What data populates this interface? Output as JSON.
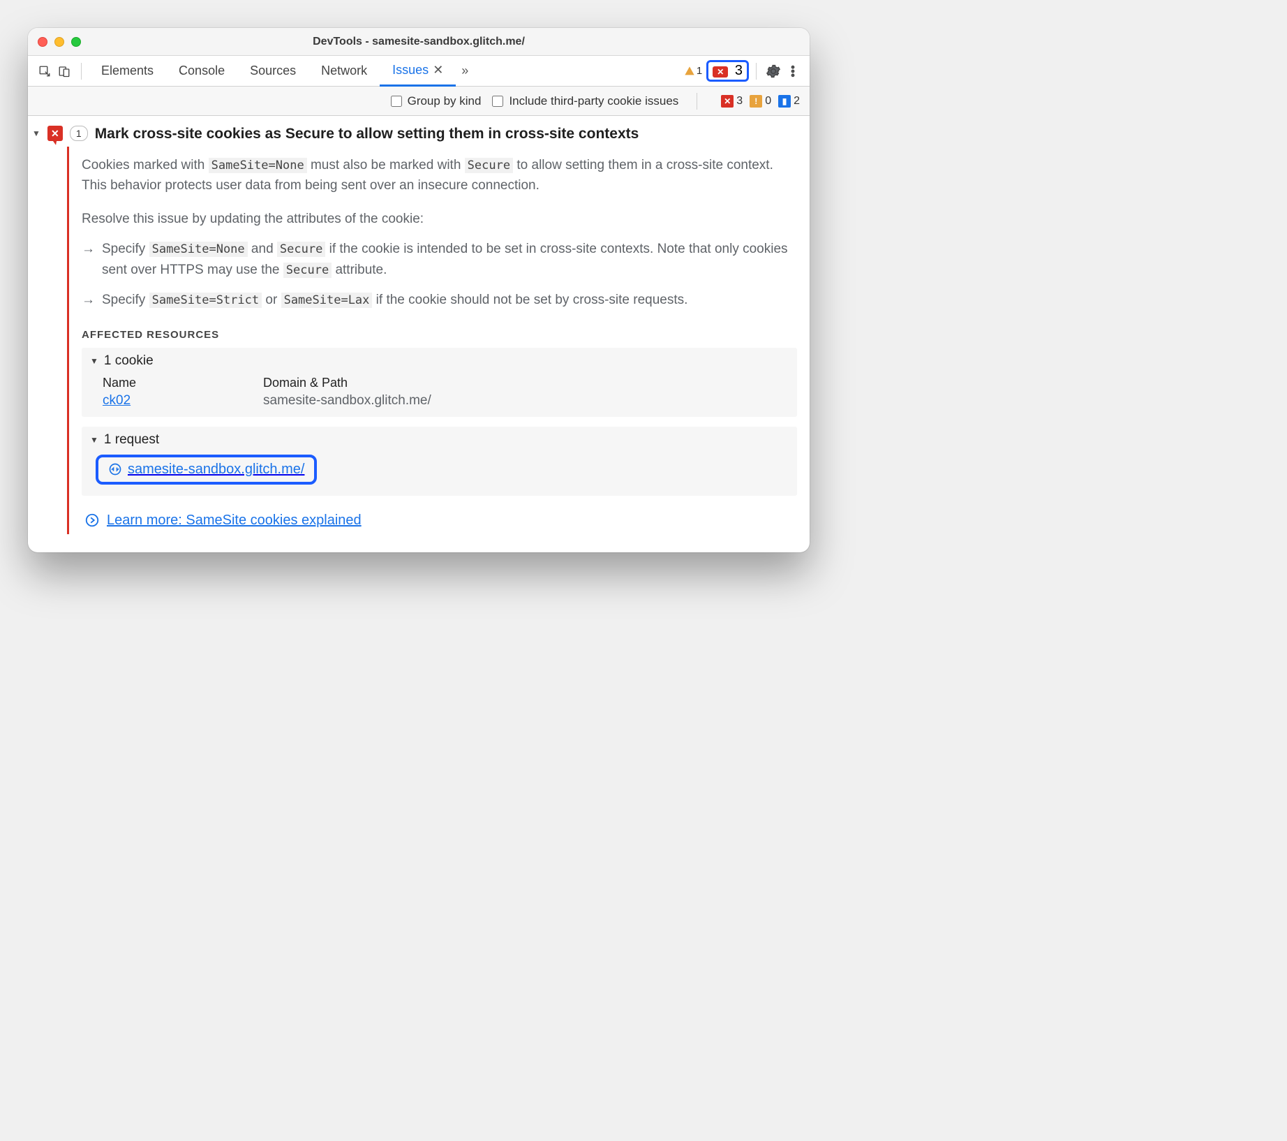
{
  "window": {
    "title": "DevTools - samesite-sandbox.glitch.me/"
  },
  "tabs": [
    "Elements",
    "Console",
    "Sources",
    "Network",
    "Issues"
  ],
  "activeTab": "Issues",
  "toolbarCounts": {
    "warnTop": "1",
    "errTop": "3"
  },
  "filter": {
    "groupByKind": "Group by kind",
    "thirdParty": "Include third-party cookie issues",
    "err": "3",
    "warn": "0",
    "info": "2"
  },
  "issue": {
    "count": "1",
    "title": "Mark cross-site cookies as Secure to allow setting them in cross-site contexts",
    "p1a": "Cookies marked with ",
    "c1": "SameSite=None",
    "p1b": " must also be marked with ",
    "c2": "Secure",
    "p1c": " to allow setting them in a cross-site context. This behavior protects user data from being sent over an insecure connection.",
    "p2": "Resolve this issue by updating the attributes of the cookie:",
    "b1a": "Specify ",
    "b1c1": "SameSite=None",
    "b1b": " and ",
    "b1c2": "Secure",
    "b1c": " if the cookie is intended to be set in cross-site contexts. Note that only cookies sent over HTTPS may use the ",
    "b1c3": "Secure",
    "b1d": " attribute.",
    "b2a": "Specify ",
    "b2c1": "SameSite=Strict",
    "b2b": " or ",
    "b2c2": "SameSite=Lax",
    "b2c": " if the cookie should not be set by cross-site requests.",
    "affectedLabel": "AFFECTED RESOURCES",
    "cookieHead": "1 cookie",
    "colName": "Name",
    "colDomain": "Domain & Path",
    "cookieRow": {
      "name": "ck02",
      "domain": "samesite-sandbox.glitch.me/"
    },
    "requestHead": "1 request",
    "requestUrl": "samesite-sandbox.glitch.me/",
    "learn": "Learn more: SameSite cookies explained"
  }
}
